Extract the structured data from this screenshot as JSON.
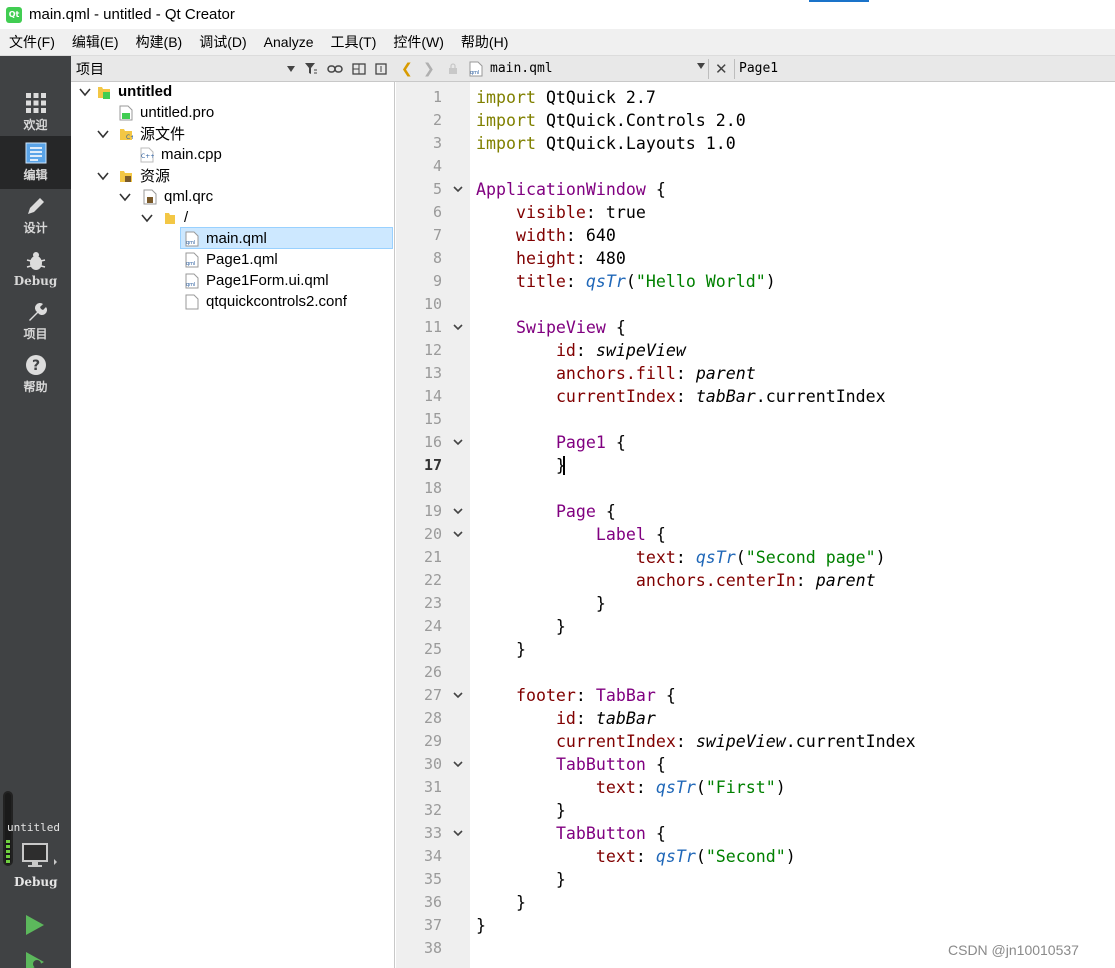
{
  "window": {
    "title": "main.qml - untitled - Qt Creator",
    "app_icon_text": "Qt"
  },
  "menubar": {
    "items": [
      "文件(F)",
      "编辑(E)",
      "构建(B)",
      "调试(D)",
      "Analyze",
      "工具(T)",
      "控件(W)",
      "帮助(H)"
    ]
  },
  "modes": {
    "items": [
      {
        "label": "欢迎",
        "icon": "grid-icon"
      },
      {
        "label": "编辑",
        "icon": "document-icon",
        "active": true
      },
      {
        "label": "设计",
        "icon": "pencil-icon"
      },
      {
        "label": "Debug",
        "icon": "bug-icon"
      },
      {
        "label": "项目",
        "icon": "wrench-icon"
      },
      {
        "label": "帮助",
        "icon": "help-icon"
      }
    ]
  },
  "kit": {
    "project": "untitled",
    "build": "Debug",
    "run_icon": "run-icon",
    "debug_run_icon": "run-debug-icon"
  },
  "projects": {
    "title": "项目",
    "tree": [
      {
        "label": "untitled",
        "bold": true
      },
      {
        "label": "untitled.pro"
      },
      {
        "label": "源文件"
      },
      {
        "label": "main.cpp"
      },
      {
        "label": "资源"
      },
      {
        "label": "qml.qrc"
      },
      {
        "label": "/"
      },
      {
        "label": "main.qml",
        "selected": true
      },
      {
        "label": "Page1.qml"
      },
      {
        "label": "Page1Form.ui.qml"
      },
      {
        "label": "qtquickcontrols2.conf"
      }
    ]
  },
  "editor": {
    "document": "main.qml",
    "symbol": "Page1",
    "current_line": 17,
    "line_numbers": [
      "1",
      "2",
      "3",
      "4",
      "5",
      "6",
      "7",
      "8",
      "9",
      "10",
      "11",
      "12",
      "13",
      "14",
      "15",
      "16",
      "17",
      "18",
      "19",
      "20",
      "21",
      "22",
      "23",
      "24",
      "25",
      "26",
      "27",
      "28",
      "29",
      "30",
      "31",
      "32",
      "33",
      "34",
      "35",
      "36",
      "37",
      "38"
    ],
    "lines": [
      "import QtQuick 2.7",
      "import QtQuick.Controls 2.0",
      "import QtQuick.Layouts 1.0",
      "",
      "ApplicationWindow {",
      "    visible: true",
      "    width: 640",
      "    height: 480",
      "    title: qsTr(\"Hello World\")",
      "",
      "    SwipeView {",
      "        id: swipeView",
      "        anchors.fill: parent",
      "        currentIndex: tabBar.currentIndex",
      "",
      "        Page1 {",
      "        }",
      "",
      "        Page {",
      "            Label {",
      "                text: qsTr(\"Second page\")",
      "                anchors.centerIn: parent",
      "            }",
      "        }",
      "    }",
      "",
      "    footer: TabBar {",
      "        id: tabBar",
      "        currentIndex: swipeView.currentIndex",
      "        TabButton {",
      "            text: qsTr(\"First\")",
      "        }",
      "        TabButton {",
      "            text: qsTr(\"Second\")",
      "        }",
      "    }",
      "}",
      ""
    ]
  },
  "watermark": "CSDN @jn10010537",
  "colors": {
    "keyword": "#808000",
    "type": "#800080",
    "property": "#800000",
    "function": "#1f67b8",
    "string": "#008000",
    "selection": "#cde8ff",
    "modebar": "#404244"
  }
}
